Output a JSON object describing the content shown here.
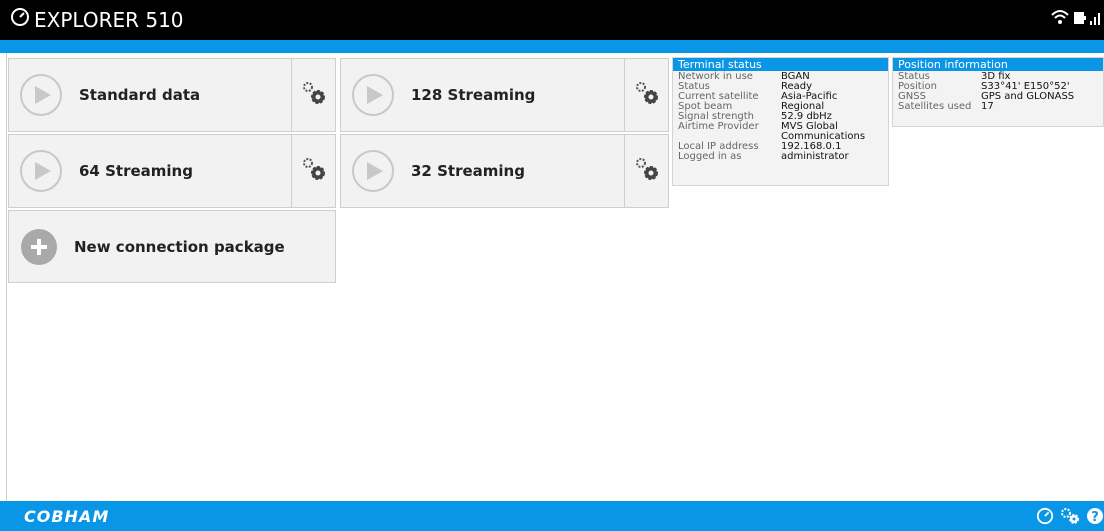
{
  "app": {
    "title": "EXPLORER 510"
  },
  "connections": [
    {
      "label": "Standard data"
    },
    {
      "label": "128 Streaming"
    },
    {
      "label": "64 Streaming"
    },
    {
      "label": "32 Streaming"
    }
  ],
  "new_package": {
    "label": "New connection package"
  },
  "terminal_status": {
    "header": "Terminal status",
    "rows": [
      {
        "k": "Network in use",
        "v": "BGAN"
      },
      {
        "k": "Status",
        "v": "Ready"
      },
      {
        "k": "Current satellite",
        "v": "Asia-Pacific"
      },
      {
        "k": "Spot beam",
        "v": "Regional"
      },
      {
        "k": "Signal strength",
        "v": "52.9 dbHz"
      },
      {
        "k": "Airtime Provider",
        "v": "MVS Global Communications"
      },
      {
        "k": "Local IP address",
        "v": "192.168.0.1"
      },
      {
        "k": "Logged in as",
        "v": "administrator"
      }
    ]
  },
  "position_info": {
    "header": "Position information",
    "rows": [
      {
        "k": "Status",
        "v": "3D fix"
      },
      {
        "k": "Position",
        "v": "S33°41' E150°52'"
      },
      {
        "k": "GNSS",
        "v": "GPS and GLONASS"
      },
      {
        "k": "Satellites used",
        "v": "17"
      }
    ]
  },
  "footer": {
    "brand": "COBHAM"
  },
  "colors": {
    "accent": "#0a96e6",
    "topbar": "#000000"
  }
}
